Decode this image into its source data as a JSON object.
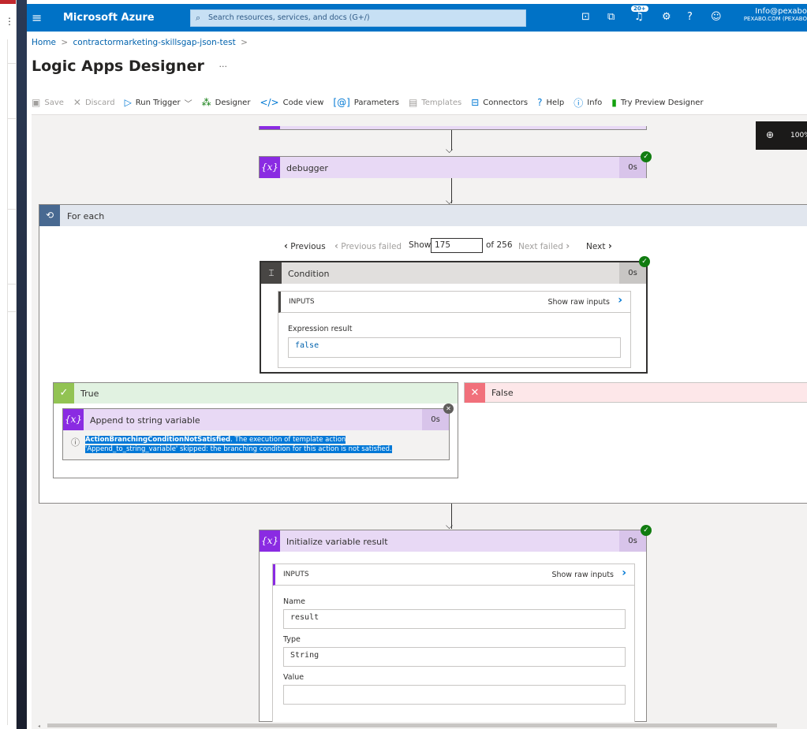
{
  "topbar": {
    "brand": "Microsoft Azure",
    "search_placeholder": "Search resources, services, and docs (G+/)",
    "notif_badge": "20+",
    "account_email": "Info@pexabo",
    "account_org": "PEXABO.COM (PEXABO"
  },
  "breadcrumb": {
    "home": "Home",
    "sep": ">",
    "item": "contractormarketing-skillsgap-json-test",
    "trail": ">"
  },
  "page_title": "Logic Apps Designer",
  "title_more": "···",
  "toolbar": {
    "save": "Save",
    "discard": "Discard",
    "run_trigger": "Run Trigger",
    "designer": "Designer",
    "code_view": "Code view",
    "parameters": "Parameters",
    "templates": "Templates",
    "connectors": "Connectors",
    "help": "Help",
    "info": "Info",
    "try_preview": "Try Preview Designer"
  },
  "zoom": {
    "level": "100%"
  },
  "debugger_step": {
    "label": "debugger",
    "duration": "0s"
  },
  "foreach": {
    "label": "For each",
    "pager": {
      "previous": "Previous",
      "previous_failed": "Previous failed",
      "show": "Show",
      "current": "175",
      "total": "of 256",
      "next_failed": "Next failed",
      "next": "Next"
    },
    "condition": {
      "label": "Condition",
      "duration": "0s",
      "inputs_label": "INPUTS",
      "show_raw": "Show raw inputs",
      "expr_label": "Expression result",
      "expr_value": "false"
    },
    "true_branch": {
      "label": "True",
      "action_label": "Append to string variable",
      "action_duration": "0s",
      "message_code": "ActionBranchingConditionNotSatisfied",
      "message_line1": ". The execution of template action",
      "message_line2": "'Append_to_string_variable' skipped: the branching condition for this action is not satisfied."
    },
    "false_branch": {
      "label": "False"
    }
  },
  "init_var": {
    "label": "Initialize variable result",
    "duration": "0s",
    "inputs_label": "INPUTS",
    "show_raw": "Show raw inputs",
    "name_label": "Name",
    "name_value": "result",
    "type_label": "Type",
    "type_value": "String",
    "value_label": "Value",
    "value_value": ""
  }
}
